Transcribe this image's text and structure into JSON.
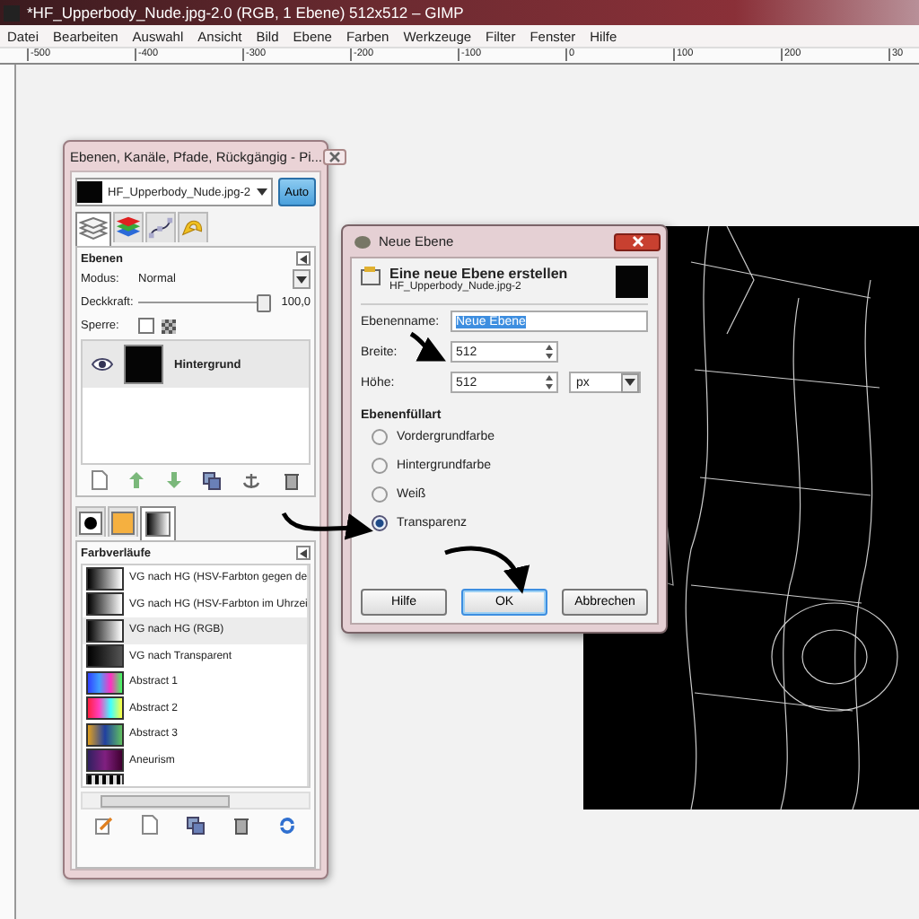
{
  "window": {
    "title": "*HF_Upperbody_Nude.jpg-2.0 (RGB, 1 Ebene) 512x512 – GIMP"
  },
  "menu": [
    "Datei",
    "Bearbeiten",
    "Auswahl",
    "Ansicht",
    "Bild",
    "Ebene",
    "Farben",
    "Werkzeuge",
    "Filter",
    "Fenster",
    "Hilfe"
  ],
  "ruler_labels": [
    "-500",
    "-400",
    "-300",
    "-200",
    "-100",
    "0",
    "100",
    "200",
    "30"
  ],
  "layers_dock": {
    "title": "Ebenen, Kanäle, Pfade, Rückgängig - Pi...",
    "image": "HF_Upperbody_Nude.jpg-2",
    "auto_button": "Auto",
    "tabs": [
      {
        "kind": "layers",
        "selected": true
      },
      {
        "kind": "channels",
        "selected": false
      },
      {
        "kind": "paths",
        "selected": false
      },
      {
        "kind": "undo",
        "selected": false
      }
    ],
    "layers_panel": {
      "heading": "Ebenen",
      "mode_label": "Modus:",
      "mode": "Normal",
      "opacity_label": "Deckkraft:",
      "opacity": {
        "level": 1.0
      },
      "opacity_value": "100,0",
      "lock_label": "Sperre:",
      "lock_checked": false,
      "layers": [
        {
          "name": "Hintergrund",
          "visible": true,
          "selected": true
        }
      ]
    },
    "lower_tabs": [
      {
        "kind": "brush",
        "selected": false
      },
      {
        "kind": "pattern",
        "selected": false
      },
      {
        "kind": "gradient",
        "selected": true
      }
    ],
    "gradients_panel": {
      "heading": "Farbverläufe",
      "items": [
        {
          "name": "VG nach HG (HSV-Farbton gegen de",
          "selected": false
        },
        {
          "name": "VG nach HG (HSV-Farbton im Uhrzei",
          "selected": false
        },
        {
          "name": "VG nach HG (RGB)",
          "selected": true
        },
        {
          "name": "VG nach Transparent",
          "selected": false
        },
        {
          "name": "Abstract 1",
          "selected": false
        },
        {
          "name": "Abstract 2",
          "selected": false
        },
        {
          "name": "Abstract 3",
          "selected": false
        },
        {
          "name": "Aneurism",
          "selected": false
        }
      ]
    }
  },
  "new_layer_dialog": {
    "title": "Neue Ebene",
    "heading": "Eine neue Ebene erstellen",
    "subtitle": "HF_Upperbody_Nude.jpg-2",
    "name_label": "Ebenenname:",
    "name_value": "Neue Ebene",
    "width_label": "Breite:",
    "width_value": "512",
    "height_label": "Höhe:",
    "height_value": "512",
    "unit": "px",
    "fill_heading": "Ebenenfüllart",
    "fill_options": [
      {
        "label": "Vordergrundfarbe",
        "selected": false
      },
      {
        "label": "Hintergrundfarbe",
        "selected": false
      },
      {
        "label": "Weiß",
        "selected": false
      },
      {
        "label": "Transparenz",
        "selected": true
      }
    ],
    "buttons": [
      {
        "label": "Hilfe",
        "default": false
      },
      {
        "label": "OK",
        "default": true
      },
      {
        "label": "Abbrechen",
        "default": false
      }
    ]
  }
}
